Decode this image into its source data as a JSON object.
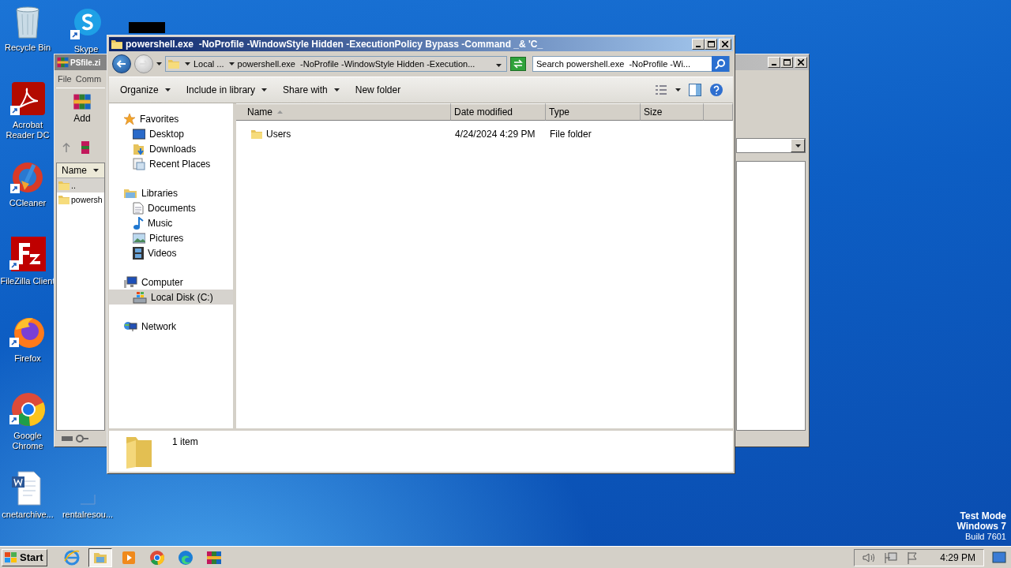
{
  "desktop_icons": [
    {
      "label": "Recycle Bin"
    },
    {
      "label": "Skype"
    },
    {
      "label": "Acrobat Reader DC"
    },
    {
      "label": "CCleaner"
    },
    {
      "label": "FileZilla Client"
    },
    {
      "label": "Firefox"
    },
    {
      "label": "Google Chrome"
    },
    {
      "label": "cnetarchive..."
    },
    {
      "label": "rentalresou..."
    }
  ],
  "background_window": {
    "title": "PSfile.zi",
    "menu": [
      "File",
      "Comm"
    ],
    "toolbar_button": "Add",
    "column": "Name",
    "rows": [
      {
        "name": "..",
        "selected": true
      },
      {
        "name": "powersh",
        "selected": false
      }
    ]
  },
  "explorer": {
    "title": "powershell.exe  -NoProfile -WindowStyle Hidden -ExecutionPolicy Bypass -Command _& 'C_",
    "breadcrumbs": [
      "Local ...",
      "powershell.exe  -NoProfile -WindowStyle Hidden -Execution..."
    ],
    "search": {
      "placeholder": "Search powershell.exe  -NoProfile -Wi..."
    },
    "toolbar": [
      {
        "label": "Organize",
        "menu": true
      },
      {
        "label": "Include in library",
        "menu": true
      },
      {
        "label": "Share with",
        "menu": true
      },
      {
        "label": "New folder",
        "menu": false
      }
    ],
    "nav": [
      {
        "label": "Favorites",
        "selected": false,
        "children": [
          {
            "label": "Desktop",
            "selected": false
          },
          {
            "label": "Downloads",
            "selected": false
          },
          {
            "label": "Recent Places",
            "selected": false
          }
        ]
      },
      {
        "label": "Libraries",
        "selected": false,
        "children": [
          {
            "label": "Documents",
            "selected": false
          },
          {
            "label": "Music",
            "selected": false
          },
          {
            "label": "Pictures",
            "selected": false
          },
          {
            "label": "Videos",
            "selected": false
          }
        ]
      },
      {
        "label": "Computer",
        "selected": false,
        "children": [
          {
            "label": "Local Disk (C:)",
            "selected": true
          }
        ]
      },
      {
        "label": "Network",
        "selected": false
      }
    ],
    "columns": [
      {
        "label": "Name",
        "sorted": true
      },
      {
        "label": "Date modified",
        "sorted": false
      },
      {
        "label": "Type",
        "sorted": false
      },
      {
        "label": "Size",
        "sorted": false
      }
    ],
    "rows": [
      {
        "name": "Users",
        "date_modified": "4/24/2024 4:29 PM",
        "type": "File folder"
      }
    ],
    "status": "1 item"
  },
  "desktop_notice": [
    "Test Mode",
    "Windows 7",
    "Build 7601"
  ],
  "taskbar": {
    "start": "Start",
    "apps": [
      {
        "selected": false
      },
      {
        "selected": true
      },
      {
        "selected": false
      },
      {
        "selected": false
      },
      {
        "selected": false
      },
      {
        "selected": false
      }
    ],
    "clock": "4:29 PM"
  }
}
